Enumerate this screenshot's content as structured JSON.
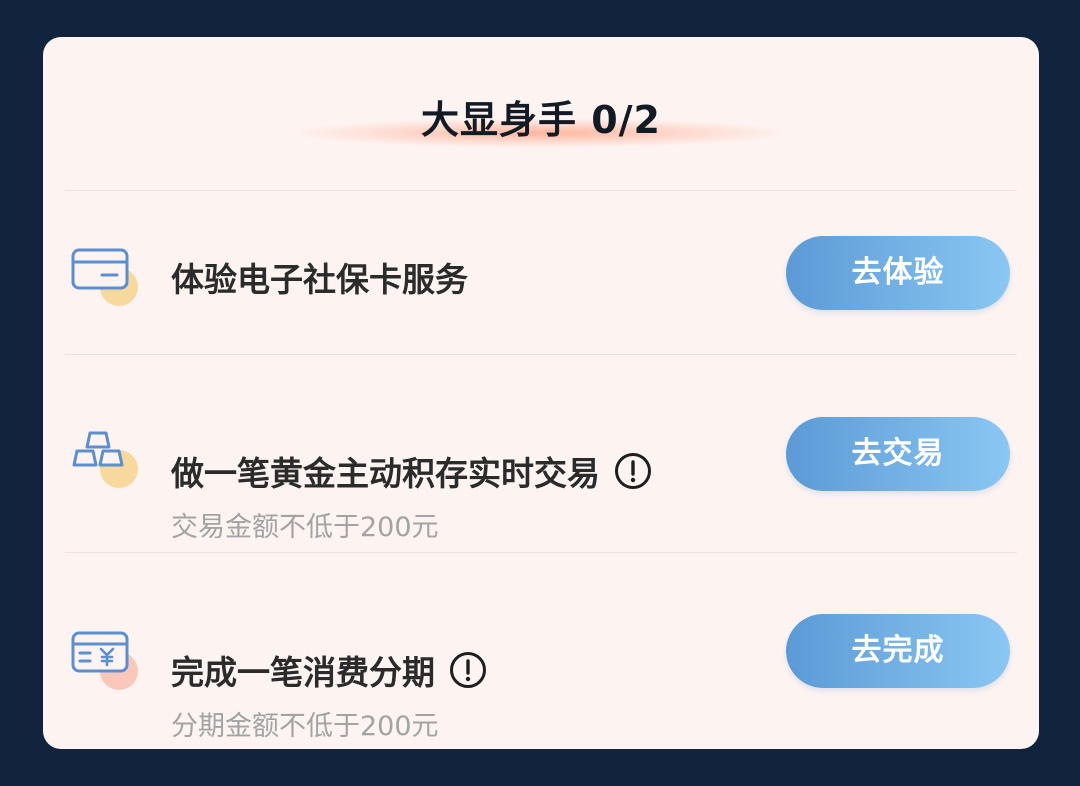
{
  "section": {
    "title": "大显身手 0/2"
  },
  "tasks": [
    {
      "title": "体验电子社保卡服务",
      "subtitle": "",
      "button_label": "去体验",
      "icon": "card-icon",
      "has_info": false
    },
    {
      "title": "做一笔黄金主动积存实时交易",
      "subtitle": "交易金额不低于200元",
      "button_label": "去交易",
      "icon": "gold-bars-icon",
      "has_info": true
    },
    {
      "title": "完成一笔消费分期",
      "subtitle": "分期金额不低于200元",
      "button_label": "去完成",
      "icon": "yuan-card-icon",
      "has_info": true
    }
  ],
  "colors": {
    "background": "#12233d",
    "card": "#fdf4f2",
    "button_start": "#5b9ad6",
    "button_end": "#8ac7f3",
    "icon_blue": "#5b8fd0",
    "icon_accent": "#f6cf86"
  }
}
